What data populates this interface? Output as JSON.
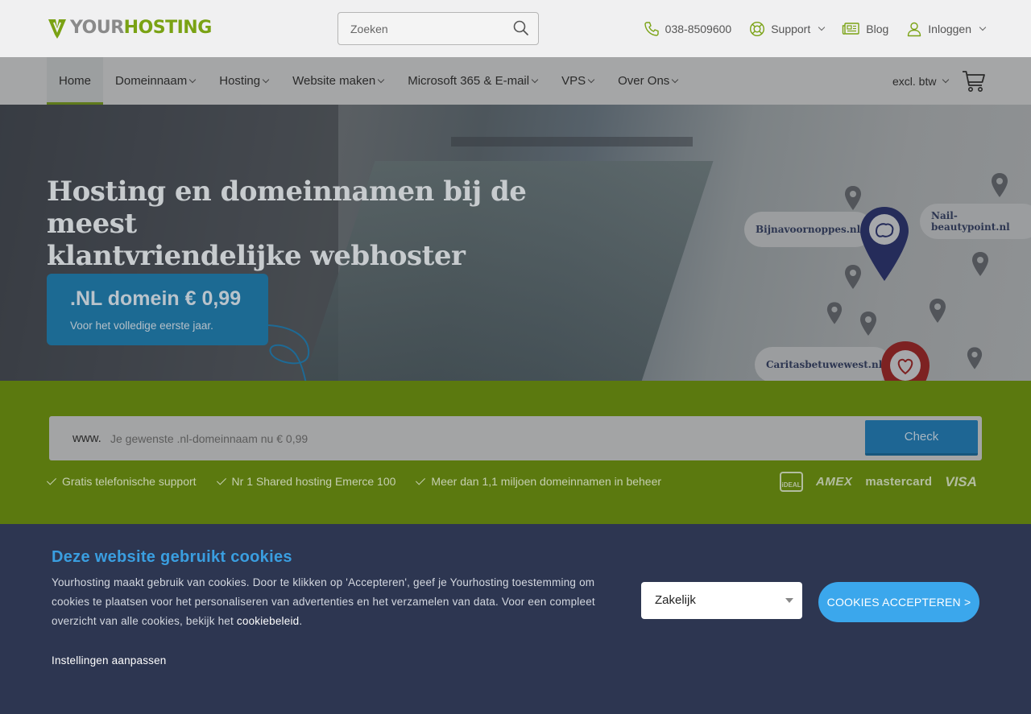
{
  "brand": {
    "logo_your": "YOUR",
    "logo_hosting": "HOSTING",
    "green": "#7aa214",
    "blue": "#3ba7ec"
  },
  "search": {
    "placeholder": "Zoeken",
    "icon": "search-icon"
  },
  "toplinks": {
    "phone": "038-8509600",
    "support": "Support",
    "blog": "Blog",
    "login": "Inloggen"
  },
  "nav": {
    "items": [
      {
        "label": "Home",
        "active": true
      },
      {
        "label": "Domeinnaam",
        "dropdown": true
      },
      {
        "label": "Hosting",
        "dropdown": true
      },
      {
        "label": "Website maken",
        "dropdown": true
      },
      {
        "label": "Microsoft 365 & E-mail",
        "dropdown": true
      },
      {
        "label": "VPS",
        "dropdown": true
      },
      {
        "label": "Over Ons",
        "dropdown": true
      }
    ],
    "vat": "excl. btw"
  },
  "hero": {
    "title_line1": "Hosting en domeinnamen bij de meest",
    "title_line2": "klantvriendelijke webhoster",
    "promo_title": ".NL domein € 0,99",
    "promo_sub": "Voor het volledige eerste jaar.",
    "map_labels": [
      "Bijnavoornoppes.nl",
      "Nail-beautypoint.nl",
      "Caritasbetuwewest.nl"
    ]
  },
  "domain_check": {
    "prefix": "www.",
    "placeholder": "Je gewenste .nl-domeinnaam nu € 0,99",
    "button": "Check"
  },
  "usps": [
    "Gratis telefonische support",
    "Nr 1 Shared hosting Emerce 100",
    "Meer dan 1,1 miljoen domeinnamen in beheer"
  ],
  "payments": {
    "ideal": "iDEAL",
    "amex": "AMEX",
    "mastercard": "mastercard",
    "visa": "VISA"
  },
  "cookie": {
    "title": "Deze website gebruikt cookies",
    "text_before": "Yourhosting maakt gebruik van cookies. Door te klikken op 'Accepteren', geef je Yourhosting toestemming om cookies te plaatsen voor het personaliseren van advertenties en het verzamelen van data. Voor een compleet overzicht van alle cookies, bekijk het ",
    "link": "cookiebeleid",
    "text_after": ".",
    "settings": "Instellingen aanpassen",
    "select_value": "Zakelijk",
    "accept": "COOKIES ACCEPTEREN >"
  }
}
